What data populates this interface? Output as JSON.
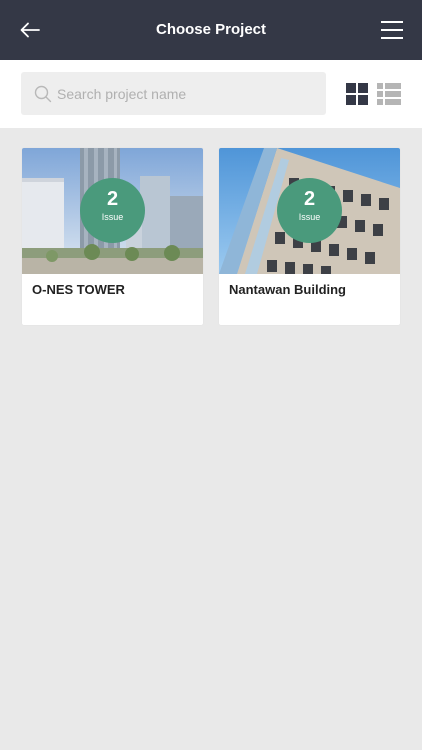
{
  "header": {
    "title": "Choose Project",
    "back_icon": "arrow-left-icon",
    "menu_icon": "hamburger-menu-icon"
  },
  "search": {
    "placeholder": "Search project name",
    "value": ""
  },
  "view_toggle": {
    "selected": "grid",
    "options": [
      "grid",
      "list"
    ]
  },
  "projects": [
    {
      "name": "O-NES TOWER",
      "issue_count": "2",
      "issue_label": "Issue"
    },
    {
      "name": "Nantawan Building",
      "issue_count": "2",
      "issue_label": "Issue"
    }
  ],
  "colors": {
    "header_bg": "#343846",
    "badge": "#4a9a7c",
    "page_bg": "#e9e9e9"
  }
}
